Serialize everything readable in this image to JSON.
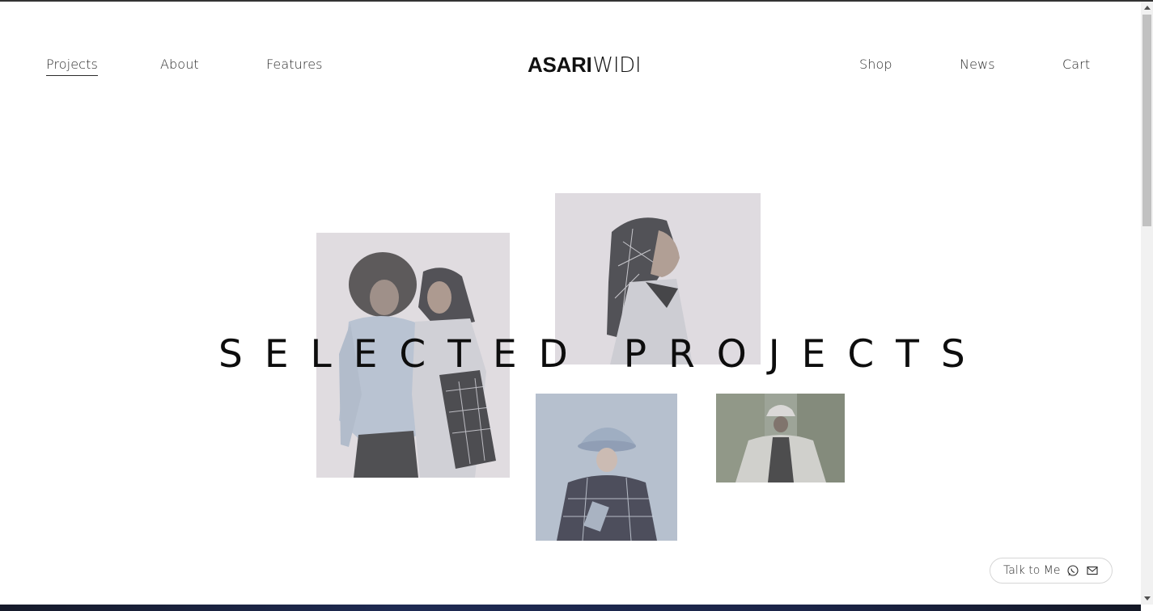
{
  "nav": {
    "left": [
      {
        "label": "Projects",
        "active": true
      },
      {
        "label": "About"
      },
      {
        "label": "Features"
      }
    ],
    "right": [
      {
        "label": "Shop"
      },
      {
        "label": "News"
      },
      {
        "label": "Cart"
      }
    ]
  },
  "logo": {
    "bold": "ASARI",
    "light": "WIDI"
  },
  "hero": {
    "headline": "SELECTED PROJECTS"
  },
  "photos": [
    {
      "name": "photo-two-models",
      "subject": "two models in grey knitwear with patterned tote"
    },
    {
      "name": "photo-headscarf-profile",
      "subject": "model in patterned headscarf, side profile"
    },
    {
      "name": "photo-bucket-hat-runway",
      "subject": "model in bucket hat and patterned top"
    },
    {
      "name": "photo-bucket-hat-outdoor",
      "subject": "model in bucket hat and jacket outdoors"
    }
  ],
  "contact_widget": {
    "label": "Talk to Me",
    "icons": [
      "whatsapp-icon",
      "mail-icon"
    ]
  },
  "colors": {
    "text": "#2b2b2b",
    "headline": "#0d0d0d",
    "photo_tint": "#d8d4d8",
    "bottom_band": "#1e2a52"
  }
}
